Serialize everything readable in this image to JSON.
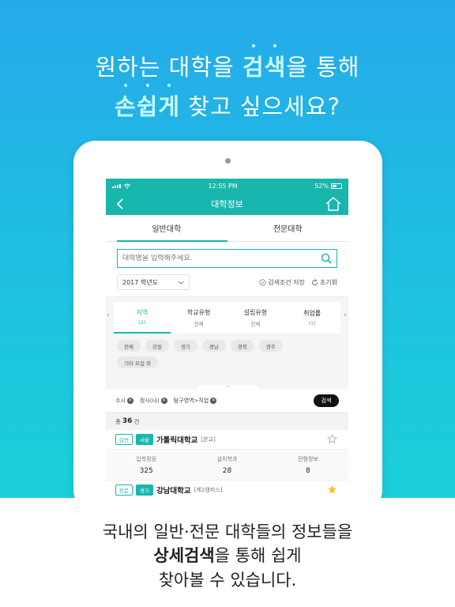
{
  "headline": {
    "line1_prefix": "원하는 대학을 ",
    "line1_highlight": "검색",
    "line1_suffix": "을 통해",
    "line2_highlight": "손쉽게",
    "line2_suffix": " 찾고 싶으세요?"
  },
  "status_bar": {
    "time": "12:55 PM",
    "battery": "52%",
    "battery_level": 0.52
  },
  "nav": {
    "title": "대학정보",
    "back_icon": "chevron-left-icon",
    "home_icon": "home-icon"
  },
  "tabs": [
    {
      "label": "일반대학",
      "active": true
    },
    {
      "label": "전문대학",
      "active": false
    }
  ],
  "search": {
    "placeholder": "대학명을 입력해주세요.",
    "icon": "search-icon"
  },
  "filters": {
    "year": "2017 학년도",
    "save_label": "검색조건 저장",
    "reset_label": "초기화"
  },
  "categories": [
    {
      "label": "지역",
      "sub": "(2)",
      "active": true
    },
    {
      "label": "학교유형",
      "sub": "전체",
      "active": false
    },
    {
      "label": "설립유형",
      "sub": "전체",
      "active": false
    },
    {
      "label": "취업률",
      "sub": "(1)",
      "active": false
    }
  ],
  "region_chips": [
    "전체",
    "강원",
    "경기",
    "경남",
    "경북",
    "광주",
    "기타 모집 외"
  ],
  "selected_filters": [
    "수시",
    "정시(나)",
    "탐구영역>직업"
  ],
  "search_button": "검색",
  "result_count": {
    "prefix": "총 ",
    "count": "36",
    "suffix": "건"
  },
  "universities": [
    {
      "type_badge": "일반",
      "region_badge": "서울",
      "name": "가톨릭대학교",
      "campus": "[본교]",
      "favorite": false,
      "stats": [
        {
          "label": "입학정원",
          "value": "325"
        },
        {
          "label": "설치학과",
          "value": "28"
        },
        {
          "label": "전형정보",
          "value": "8"
        }
      ]
    },
    {
      "type_badge": "전문",
      "region_badge": "경기",
      "name": "강남대학교",
      "campus": "[제2캠퍼스]",
      "favorite": true
    }
  ],
  "caption": {
    "line1": "국내의 일반·전문 대학들의 정보들을",
    "line2_bold": "상세검색",
    "line2_rest": "을 통해 쉽게",
    "line3": "찾아볼 수 있습니다."
  },
  "colors": {
    "accent": "#19b6ad",
    "gradient_top": "#25a9ea",
    "gradient_bottom": "#1bcfd9",
    "star": "#f5c21b"
  }
}
